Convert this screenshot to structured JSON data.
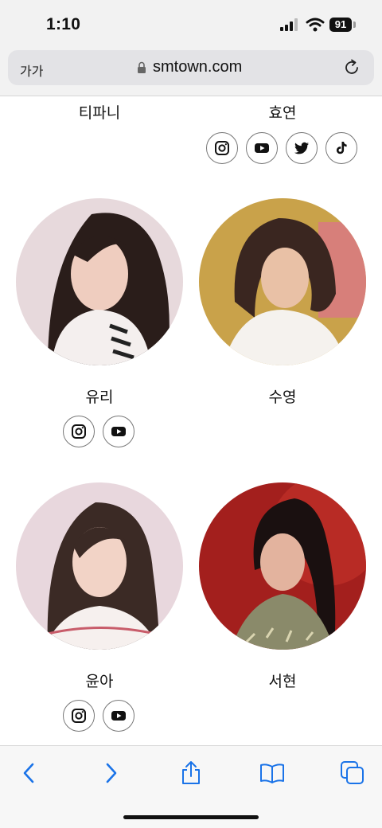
{
  "status_bar": {
    "time": "1:10",
    "battery_level": "91"
  },
  "address_bar": {
    "text_size_label": "가가",
    "url": "smtown.com"
  },
  "members": [
    {
      "name": "티파니",
      "socials": []
    },
    {
      "name": "효연",
      "socials": [
        "instagram-icon",
        "youtube-icon",
        "twitter-icon",
        "tiktok-icon"
      ]
    },
    {
      "name": "유리",
      "socials": [
        "instagram-icon",
        "youtube-icon"
      ]
    },
    {
      "name": "수영",
      "socials": []
    },
    {
      "name": "윤아",
      "socials": [
        "instagram-icon",
        "youtube-icon"
      ]
    },
    {
      "name": "서현",
      "socials": []
    }
  ],
  "toolbar": {
    "buttons": [
      "back-icon",
      "forward-icon",
      "share-icon",
      "bookmarks-icon",
      "tabs-icon"
    ]
  },
  "colors": {
    "accent": "#1a73e8",
    "toolbar_bg": "#f7f7f7",
    "chrome_bg": "#f2f2f2"
  }
}
